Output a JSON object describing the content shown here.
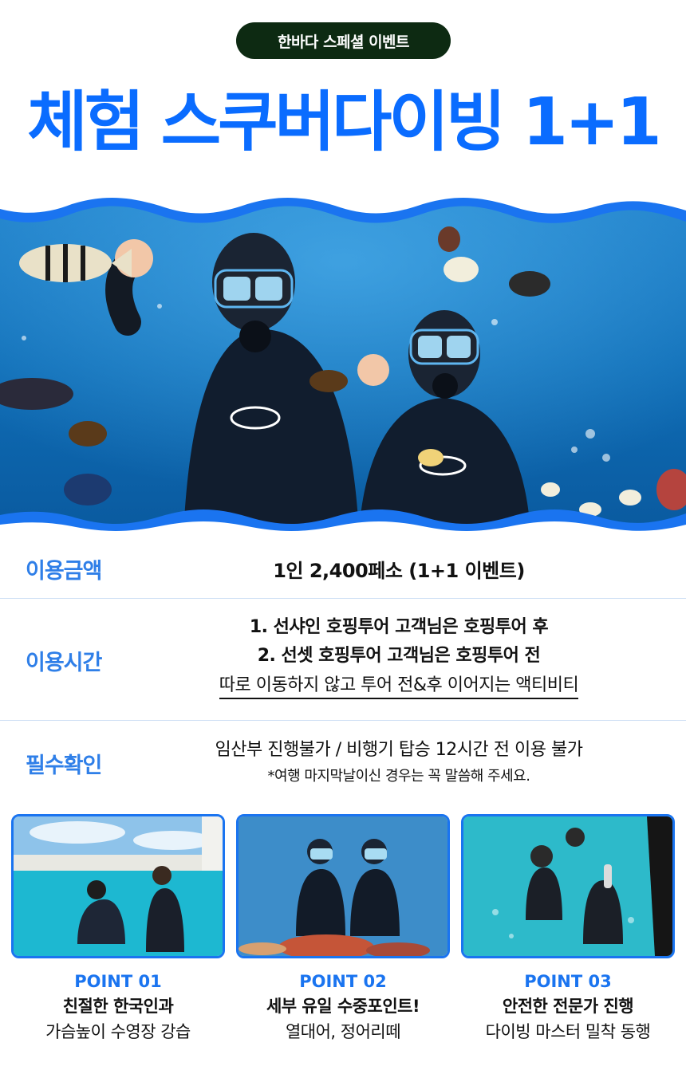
{
  "header": {
    "badge": "한바다 스페셜 이벤트",
    "headline": "체험 스쿠버다이빙 1+1"
  },
  "colors": {
    "accent": "#0a6cff",
    "label_blue": "#2f7fe8",
    "badge_bg": "#0d2a12",
    "card_border": "#1a74f0"
  },
  "info": {
    "price": {
      "label": "이용금액",
      "value": "1인 2,400페소 (1+1 이벤트)"
    },
    "time": {
      "label": "이용시간",
      "line1": "1. 선샤인 호핑투어 고객님은 호핑투어 후",
      "line2": "2. 선셋 호핑투어 고객님은 호핑투어 전",
      "note": "따로 이동하지 않고 투어 전&후 이어지는 액티비티"
    },
    "required": {
      "label": "필수확인",
      "main": "임산부 진행불가 / 비행기 탑승 12시간 전 이용 불가",
      "sub": "*여행 마지막날이신 경우는 꼭 말씀해 주세요."
    }
  },
  "points": [
    {
      "title": "POINT 01",
      "line1": "친절한 한국인과",
      "line2": "가슴높이 수영장 강습"
    },
    {
      "title": "POINT 02",
      "line1": "세부 유일 수중포인트!",
      "line2": "열대어, 정어리떼"
    },
    {
      "title": "POINT 03",
      "line1": "안전한 전문가 진행",
      "line2": "다이빙 마스터 밀착 동행"
    }
  ]
}
